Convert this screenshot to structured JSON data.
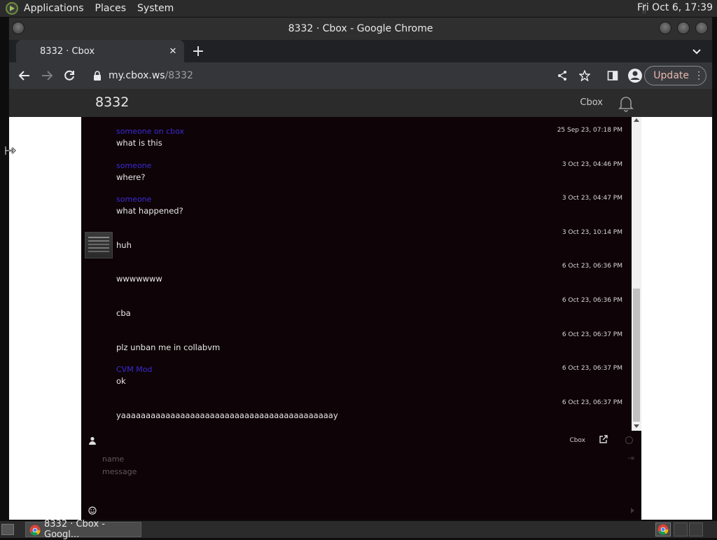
{
  "top_panel": {
    "menus": [
      "Applications",
      "Places",
      "System"
    ],
    "clock": "Fri Oct  6, 17:39"
  },
  "window": {
    "title": "8332 · Cbox - Google Chrome"
  },
  "tab": {
    "title": "8332 · Cbox",
    "close": "✕",
    "new_tab": "+"
  },
  "toolbar": {
    "url_host": "my.cbox.ws",
    "url_path": "/8332",
    "update_label": "Update"
  },
  "cbox": {
    "title": "8332",
    "brand": "Cbox",
    "input_brand": "Cbox",
    "name_placeholder": "name",
    "message_placeholder": "message"
  },
  "messages": [
    {
      "author": "someone on cbox",
      "text": "what is this",
      "time": "25 Sep 23, 07:18 PM",
      "avatar": false
    },
    {
      "author": "someone",
      "text": "where?",
      "time": "3 Oct 23, 04:46 PM",
      "avatar": false
    },
    {
      "author": "someone",
      "text": "what happened?",
      "time": "3 Oct 23, 04:47 PM",
      "avatar": false
    },
    {
      "author": "",
      "text": "huh",
      "time": "3 Oct 23, 10:14 PM",
      "avatar": true
    },
    {
      "author": "",
      "text": "wwwwwww",
      "time": "6 Oct 23, 06:36 PM",
      "avatar": false
    },
    {
      "author": "",
      "text": "cba",
      "time": "6 Oct 23, 06:36 PM",
      "avatar": false
    },
    {
      "author": "",
      "text": "plz unban me in collabvm",
      "time": "6 Oct 23, 06:37 PM",
      "avatar": false
    },
    {
      "author": "CVM Mod",
      "text": "ok",
      "time": "6 Oct 23, 06:37 PM",
      "avatar": false
    },
    {
      "author": "",
      "text": "yaaaaaaaaaaaaaaaaaaaaaaaaaaaaaaaaaaaaaaaaaaay",
      "time": "6 Oct 23, 06:37 PM",
      "avatar": false
    }
  ],
  "taskbar": {
    "task_label": "8332 · Cbox - Googl..."
  },
  "colors": {
    "chat_bg": "#0e0306",
    "author": "#3a2bd6",
    "header_bg": "#2b2b2b"
  }
}
